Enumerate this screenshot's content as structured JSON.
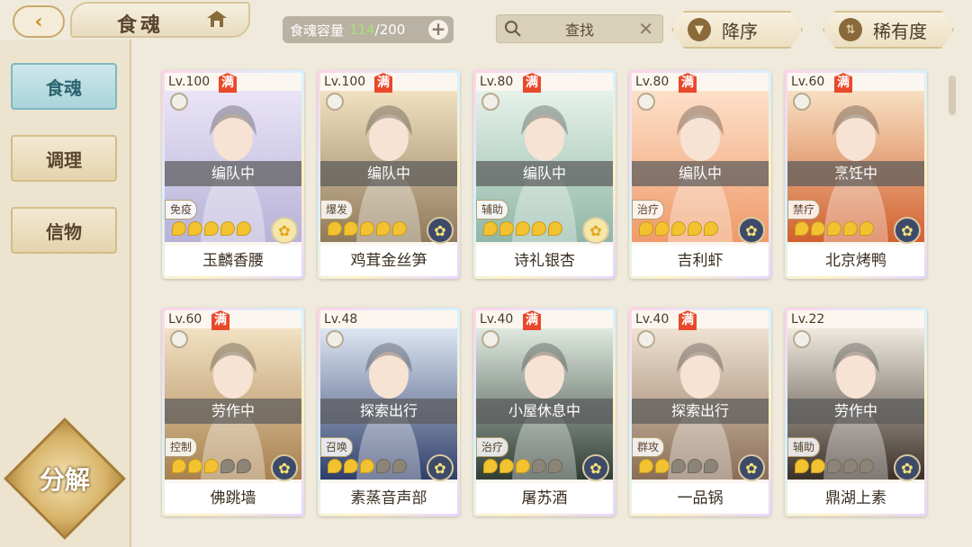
{
  "header": {
    "title": "食魂",
    "capacity_label": "食魂容量",
    "capacity_current": "114",
    "capacity_max": "/200",
    "capacity_add": "+",
    "search_label": "查找",
    "search_clear": "✕",
    "sort_label": "降序",
    "rarity_label": "稀有度"
  },
  "sidebar": {
    "tabs": [
      {
        "label": "食魂",
        "active": true
      },
      {
        "label": "调理",
        "active": false
      },
      {
        "label": "信物",
        "active": false
      }
    ],
    "decompose_label": "分解"
  },
  "cards": [
    {
      "level": "Lv.100",
      "full": "满",
      "status": "编队中",
      "role": "免疫",
      "name": "玉麟香腰",
      "stars": 5,
      "badge": "gold",
      "palette": [
        "#e9e4f6",
        "#b7b2d8"
      ]
    },
    {
      "level": "Lv.100",
      "full": "满",
      "status": "编队中",
      "role": "爆发",
      "name": "鸡茸金丝笋",
      "stars": 5,
      "badge": "dark",
      "palette": [
        "#f1e1c1",
        "#8f7a5a"
      ]
    },
    {
      "level": "Lv.80",
      "full": "满",
      "status": "编队中",
      "role": "辅助",
      "name": "诗礼银杏",
      "stars": 5,
      "badge": "gold",
      "palette": [
        "#e6f2ea",
        "#8fb6a6"
      ]
    },
    {
      "level": "Lv.80",
      "full": "满",
      "status": "编队中",
      "role": "治疗",
      "name": "吉利虾",
      "stars": 5,
      "badge": "dark",
      "palette": [
        "#fde0c9",
        "#ef9a6a"
      ]
    },
    {
      "level": "Lv.60",
      "full": "满",
      "status": "烹饪中",
      "role": "禁疗",
      "name": "北京烤鸭",
      "stars": 5,
      "badge": "dark",
      "palette": [
        "#f7e0c2",
        "#d2602e"
      ]
    },
    {
      "level": "Lv.60",
      "full": "满",
      "status": "劳作中",
      "role": "控制",
      "name": "佛跳墙",
      "stars": 3,
      "badge": "dark",
      "palette": [
        "#f2e1c3",
        "#a8814e"
      ]
    },
    {
      "level": "Lv.48",
      "full": "",
      "status": "探索出行",
      "role": "召唤",
      "name": "素蒸音声部",
      "stars": 3,
      "badge": "dark",
      "palette": [
        "#dde6f3",
        "#2f3f6a"
      ]
    },
    {
      "level": "Lv.40",
      "full": "满",
      "status": "小屋休息中",
      "role": "治疗",
      "name": "屠苏酒",
      "stars": 3,
      "badge": "dark",
      "palette": [
        "#dfe9e0",
        "#2f3d35"
      ]
    },
    {
      "level": "Lv.40",
      "full": "满",
      "status": "探索出行",
      "role": "群攻",
      "name": "一品锅",
      "stars": 2,
      "badge": "dark",
      "palette": [
        "#efe2d2",
        "#8a6d56"
      ]
    },
    {
      "level": "Lv.22",
      "full": "",
      "status": "劳作中",
      "role": "辅助",
      "name": "鼎湖上素",
      "stars": 2,
      "badge": "dark",
      "palette": [
        "#efe9df",
        "#3a3028"
      ]
    }
  ]
}
